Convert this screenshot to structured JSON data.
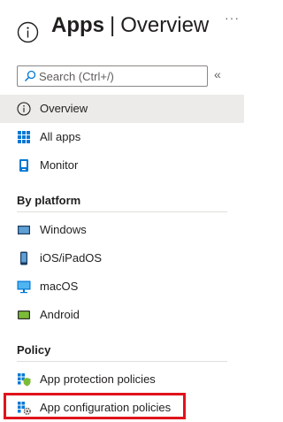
{
  "header": {
    "title_bold": "Apps",
    "title_sep": "|",
    "title_sub": "Overview",
    "more": "···"
  },
  "search": {
    "placeholder": "Search (Ctrl+/)",
    "collapse": "«"
  },
  "nav": {
    "overview": "Overview",
    "all_apps": "All apps",
    "monitor": "Monitor"
  },
  "by_platform": {
    "heading": "By platform",
    "items": [
      "Windows",
      "iOS/iPadOS",
      "macOS",
      "Android"
    ]
  },
  "policy": {
    "heading": "Policy",
    "items": [
      "App protection policies",
      "App configuration policies"
    ]
  },
  "colors": {
    "accent": "#0078d4",
    "selected_bg": "#edebe9",
    "highlight": "#e0131c"
  }
}
